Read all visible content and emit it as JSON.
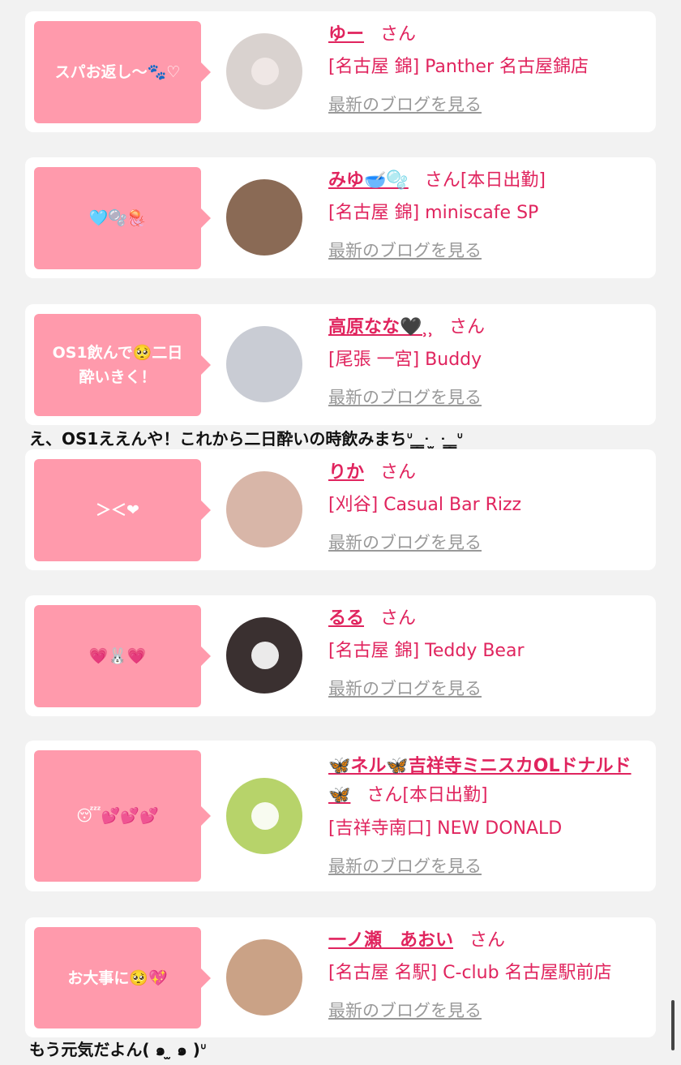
{
  "cards": [
    {
      "bubble": "スパお返し〜🐾♡",
      "name": "ゆー",
      "san": "さん",
      "status": "",
      "shop": "[名古屋 錦] Panther 名古屋錦店",
      "blog": "最新のブログを見る",
      "avatar_color": "#d9d2cf"
    },
    {
      "bubble": "🩵🫧🪼",
      "name": "みゆ🥣🫧",
      "san": "さん",
      "status": "[本日出勤]",
      "shop": "[名古屋 錦] miniscafe SP",
      "blog": "最新のブログを見る",
      "avatar_color": "#8a6a55"
    },
    {
      "bubble": "OS1飲んで🥺二日\n酔いきく！",
      "name": "高原なな🖤⸒⸒",
      "san": "さん",
      "status": "",
      "shop": "[尾張 一宮] Buddy",
      "blog": "最新のブログを見る",
      "avatar_color": "#c9ccd4"
    },
    {
      "bubble": "＞＜❤",
      "name": "りか",
      "san": "さん",
      "status": "",
      "shop": "[刈谷] Casual Bar Rizz",
      "blog": "最新のブログを見る",
      "avatar_color": "#d8b6a8"
    },
    {
      "bubble": "💗🐰💗",
      "name": "るる",
      "san": "さん",
      "status": "",
      "shop": "[名古屋 錦] Teddy Bear",
      "blog": "最新のブログを見る",
      "avatar_color": "#3a3030"
    },
    {
      "bubble": "😴💕💕💕",
      "name": "🦋ネル🦋吉祥寺ミニスカOLドナルド🦋",
      "san": "さん",
      "status": "[本日出勤]",
      "shop": "[吉祥寺南口] NEW DONALD",
      "blog": "最新のブログを見る",
      "avatar_color": "#b7d36a"
    },
    {
      "bubble": "お大事に🥺💖",
      "name": "一ノ瀬　あおい",
      "san": "さん",
      "status": "",
      "shop": "[名古屋 名駅] C-club 名古屋駅前店",
      "blog": "最新のブログを見る",
      "avatar_color": "#caa286"
    }
  ],
  "comments": [
    "え、OS1ええんや！これから二日酔いの時飲みまちᐡ ̳ ̳ᐧ ̫ ᐧ ̳ ̳ᐡ",
    "もう元気だよん( ๑ ̫ ๑ )ᐡ"
  ]
}
